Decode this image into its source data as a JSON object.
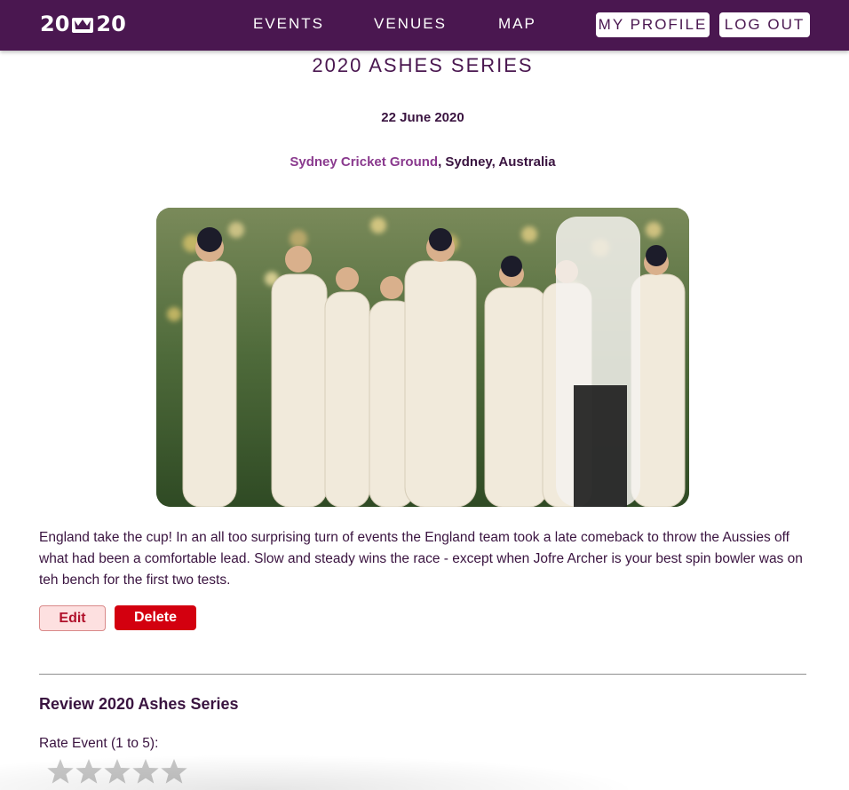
{
  "nav": {
    "logo_left": "20",
    "logo_right": "20",
    "links": [
      "EVENTS",
      "VENUES",
      "MAP"
    ],
    "profile_label": "MY PROFILE",
    "logout_label": "LOG OUT"
  },
  "event": {
    "title": "2020 ASHES SERIES",
    "date": "22 June 2020",
    "venue_name": "Sydney Cricket Ground",
    "venue_location": ", Sydney, Australia",
    "description": "England take the cup! In an all too surprising turn of events the England team took a late comeback to throw the Aussies off what had been a comfortable lead. Slow and steady wins the race - except when Jofre Archer is your best spin bowler was on teh bench for the first two tests."
  },
  "actions": {
    "edit_label": "Edit",
    "delete_label": "Delete"
  },
  "review": {
    "heading": "Review 2020 Ashes Series",
    "rate_label": "Rate Event (1 to 5):",
    "star_count": 5,
    "rating": 0
  },
  "colors": {
    "brand": "#4a1750",
    "link": "#8a3a8e",
    "danger": "#d3000f",
    "edit_bg": "#fde0e0",
    "star_empty": "#c8c8c8"
  }
}
